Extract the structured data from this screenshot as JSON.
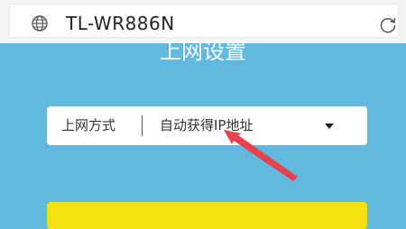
{
  "address_bar": {
    "site_name": "TL-WR886N",
    "left_icon": "globe-icon",
    "right_icon": "reload-icon"
  },
  "page": {
    "heading": "上网设置"
  },
  "connection_type": {
    "label": "上网方式",
    "selected": "自动获得IP地址",
    "dropdown_icon": "caret-down-icon"
  },
  "annotation": {
    "icon": "red-arrow-icon"
  },
  "colors": {
    "background": "#62b9e0",
    "button": "#f5e10f",
    "arrow": "#e8424d"
  }
}
